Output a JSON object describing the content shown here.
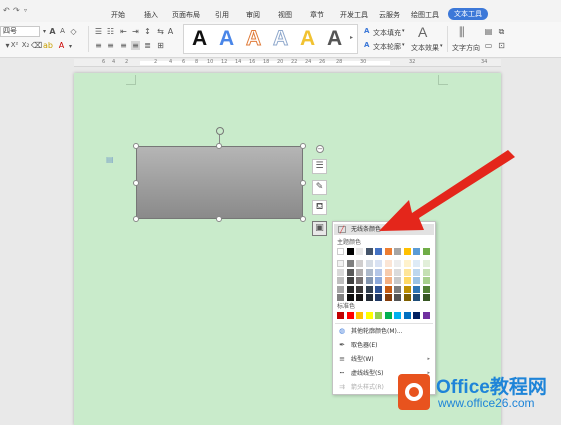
{
  "tabs": {
    "home": "开始",
    "insert": "插入",
    "page_layout": "页面布局",
    "reference": "引用",
    "review": "审阅",
    "view": "视图",
    "chapter": "章节",
    "dev_tools": "开发工具",
    "cloud": "云服务",
    "drawing_tools": "绘图工具",
    "text_tools": "文本工具"
  },
  "ribbon": {
    "font_size": "四号",
    "text_fill": "文本填充",
    "text_outline": "文本轮廓",
    "text_effect": "文本效果",
    "text_direction": "文字方向",
    "gallery_letter": "A"
  },
  "ruler_numbers": [
    "6",
    "4",
    "2",
    "2",
    "4",
    "6",
    "8",
    "10",
    "12",
    "14",
    "16",
    "18",
    "20",
    "22",
    "24",
    "26",
    "28",
    "30",
    "32",
    "34"
  ],
  "menu": {
    "no_outline": "无线条颜色",
    "theme_colors": "主题颜色",
    "standard_colors": "标准色",
    "more_colors": "其他轮廓颜色(M)...",
    "eyedropper": "取色器(E)",
    "line_type": "线型(W)",
    "dash_type": "虚线线型(S)",
    "arrow_style": "箭头样式(R)"
  },
  "colors": {
    "theme_top": [
      "#ffffff",
      "#000000",
      "#e7e6e6",
      "#44546a",
      "#4472c4",
      "#ed7d31",
      "#a5a5a5",
      "#ffc000",
      "#5b9bd5",
      "#70ad47"
    ],
    "theme_shades": [
      [
        "#f2f2f2",
        "#7f7f7f",
        "#d0cece",
        "#d6dce4",
        "#d9e2f3",
        "#fbe5d5",
        "#ededed",
        "#fff2cc",
        "#deebf6",
        "#e2efd9"
      ],
      [
        "#d9d9d9",
        "#595959",
        "#aeabab",
        "#adb9ca",
        "#b4c6e7",
        "#f7cbac",
        "#dbdbdb",
        "#fee599",
        "#bdd7ee",
        "#c5e0b3"
      ],
      [
        "#bfbfbf",
        "#3f3f3f",
        "#757070",
        "#8496b0",
        "#8eaadb",
        "#f4b083",
        "#c9c9c9",
        "#ffd965",
        "#9cc3e5",
        "#a8d08d"
      ],
      [
        "#a5a5a5",
        "#262626",
        "#3a3838",
        "#323f4f",
        "#2f5496",
        "#c55a11",
        "#7b7b7b",
        "#bf9000",
        "#2e75b5",
        "#538135"
      ],
      [
        "#7f7f7f",
        "#0c0c0c",
        "#171616",
        "#222a35",
        "#1f3864",
        "#833c0b",
        "#525252",
        "#7f6000",
        "#1f4e79",
        "#375623"
      ]
    ],
    "standard": [
      "#c00000",
      "#ff0000",
      "#ffc000",
      "#ffff00",
      "#92d050",
      "#00b050",
      "#00b0f0",
      "#0070c0",
      "#002060",
      "#7030a0"
    ],
    "gallery": [
      "#111111",
      "#4a86e8",
      "#e0b070",
      "#c7d3e6",
      "#f1c232",
      "#555555"
    ],
    "accent": "#3c78d8",
    "arrow": "#e4261b"
  },
  "watermark": {
    "title": "Office教程网",
    "url": "www.office26.com"
  }
}
